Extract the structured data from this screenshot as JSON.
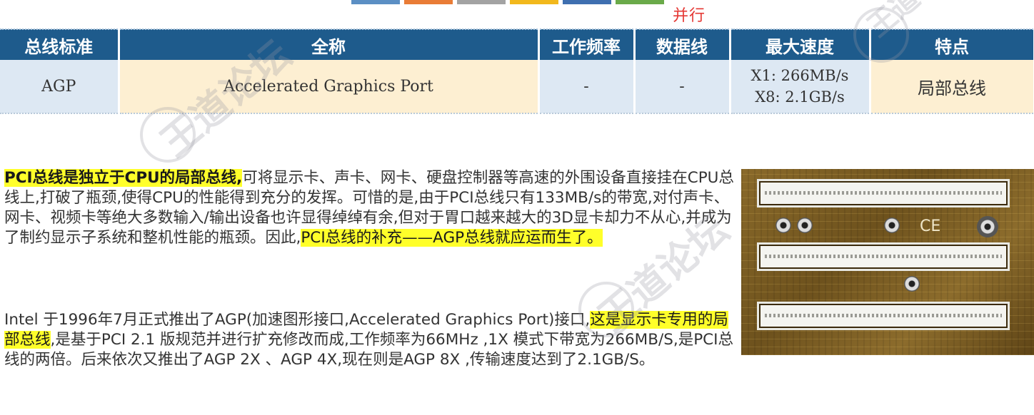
{
  "top_strip": {
    "colors": [
      "#5b8fc4",
      "#e97c36",
      "#a3a3a3",
      "#f2b81c",
      "#3f6fb0",
      "#6aaa4a"
    ]
  },
  "top_note": "并行",
  "table": {
    "headers": [
      "总线标准",
      "全称",
      "工作频率",
      "数据线",
      "最大速度",
      "特点"
    ],
    "row": {
      "standard": "AGP",
      "full_name": "Accelerated Graphics Port",
      "frequency": "-",
      "data_lines": "-",
      "speed_line1": "X1: 266MB/s",
      "speed_line2": "X8: 2.1GB/s",
      "feature": "局部总线"
    }
  },
  "paragraph1": {
    "highlight1": "PCI总线是独立于CPU的局部总线,",
    "text1": "可将显示卡、声卡、网卡、硬盘控制器等高速的外围设备直接挂在CPU总线上,打破了瓶颈,使得CPU的性能得到充分的发挥。可惜的是,由于PCI总线只有133MB/s的带宽,对付声卡、网卡、视频卡等绝大多数输入/输出设备也许显得绰绰有余,但对于胃口越来越大的3D显卡却力不从心,并成为了制约显示子系统和整机性能的瓶颈。因此,",
    "highlight2": "PCI总线的补充——AGP总线就应运而生了。"
  },
  "paragraph2": {
    "text1": "Intel 于1996年7月正式推出了AGP(加速图形接口,Accelerated Graphics Port)接口,",
    "highlight": "这是显示卡专用的局部总线",
    "text2": ",是基于PCI 2.1 版规范并进行扩充修改而成,工作频率为66MHz ,1X 模式下带宽为266MB/S,是PCI总线的两倍。后来依次又推出了AGP 2X 、AGP 4X,现在则是AGP 8X ,传输速度达到了2.1GB/S。"
  },
  "photo": {
    "mark": "CE"
  },
  "watermark": {
    "text": "王道论坛",
    "url": "WWW.CSKAOYAN.COM"
  },
  "colors": {
    "header_bg": "#1e5b8c",
    "cell_blue": "#dde8f3",
    "cell_cream": "#fdefd2",
    "highlight": "#ffff2a",
    "note_red": "#e53935"
  }
}
